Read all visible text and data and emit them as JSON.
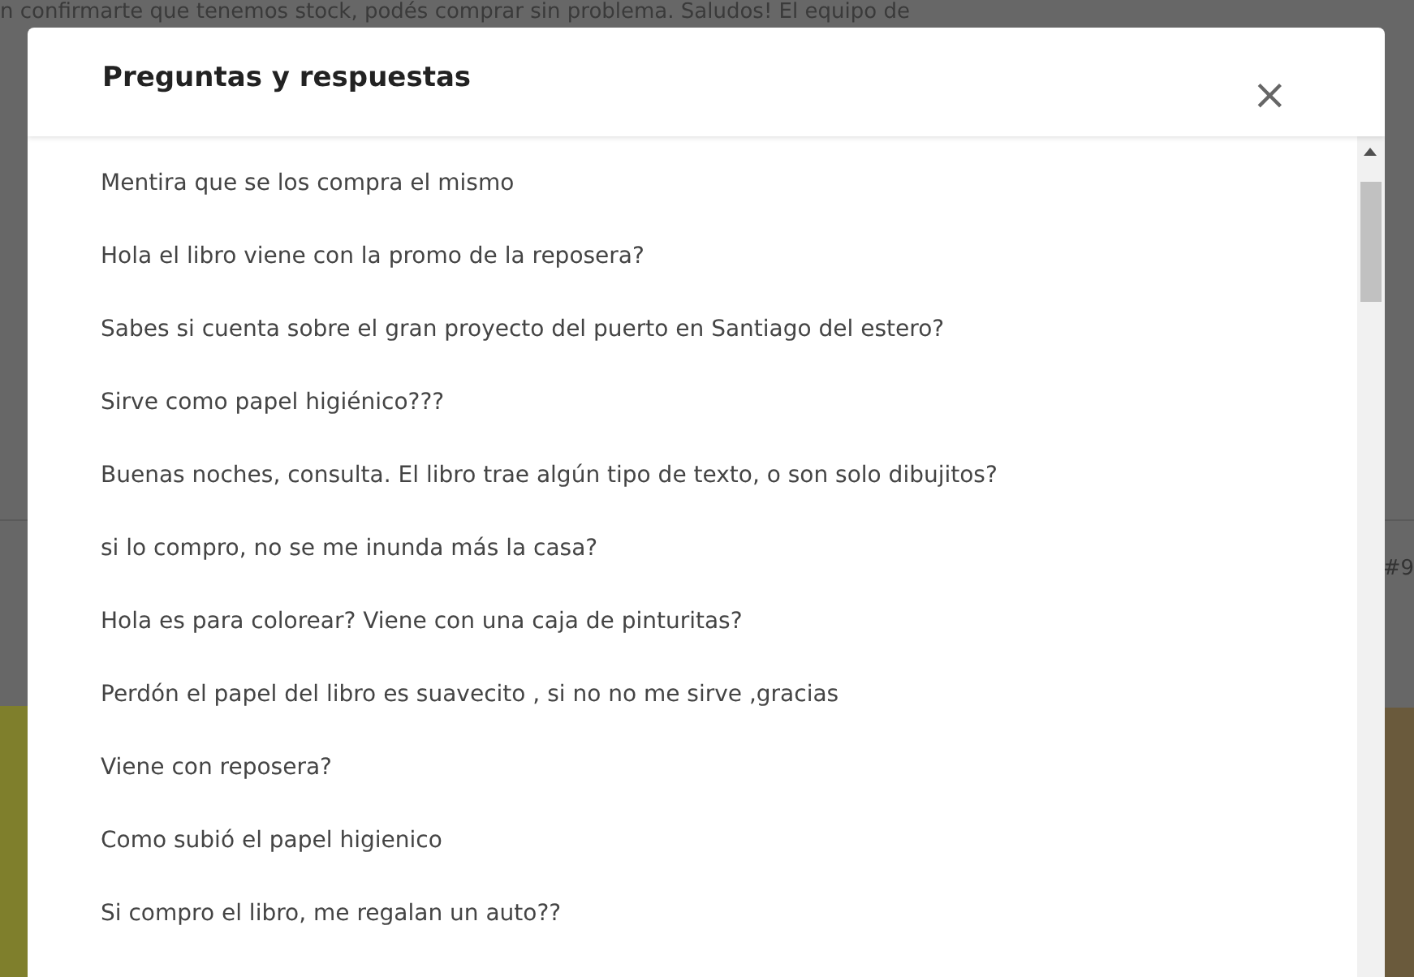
{
  "background": {
    "text": "n confirmarte que tenemos stock, podés comprar sin problema. Saludos! El equipo de",
    "corner_text": "#9"
  },
  "dialog": {
    "title": "Preguntas y respuestas",
    "close": "×",
    "questions": [
      "Mentira que se los compra el mismo",
      "Hola el libro viene con la promo de la reposera?",
      "Sabes si cuenta sobre el gran proyecto del puerto en Santiago del estero?",
      "Sirve como papel higiénico???",
      "Buenas noches, consulta. El libro trae algún tipo de texto, o son solo dibujitos?",
      "si lo compro, no se me inunda más la casa?",
      "Hola es para colorear? Viene con una caja de pinturitas?",
      "Perdón el papel del libro es suavecito , si no no me sirve ,gracias",
      "Viene con reposera?",
      "Como subió el papel higienico",
      "Si compro el libro, me regalan un auto??"
    ]
  }
}
